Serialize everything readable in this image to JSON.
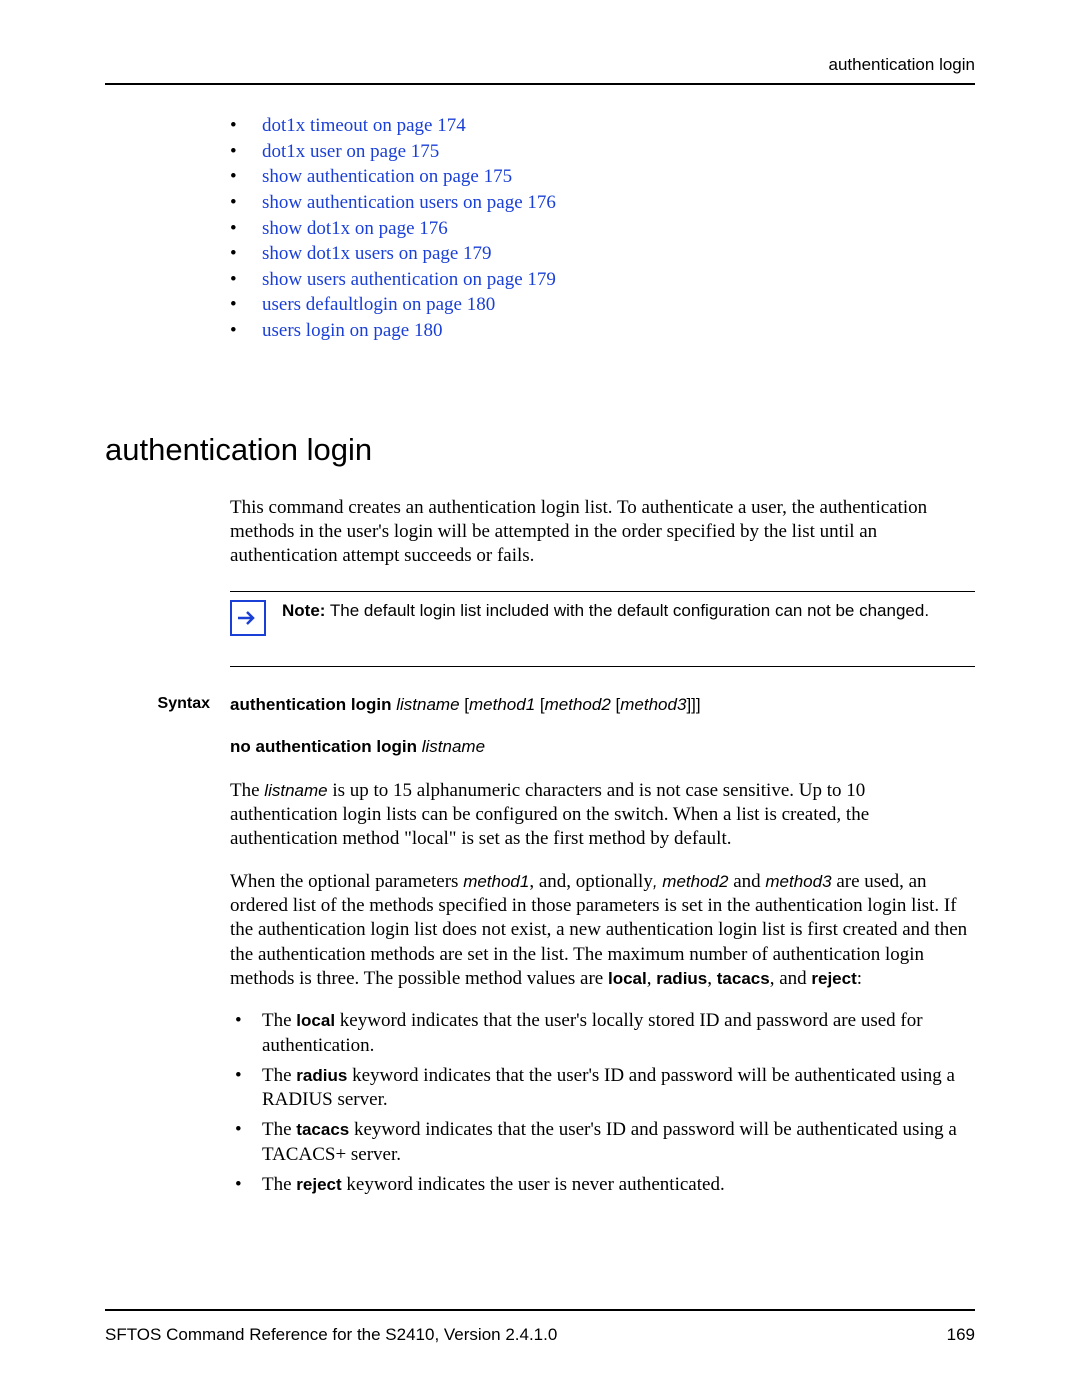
{
  "header": {
    "right": "authentication login"
  },
  "links": [
    "dot1x timeout on page 174",
    "dot1x user on page 175",
    "show authentication on page 175",
    "show authentication users on page 176",
    "show dot1x on page 176",
    "show dot1x users on page 179",
    "show users authentication on page 179",
    "users defaultlogin on page 180",
    "users login on page 180"
  ],
  "section": {
    "title": "authentication login",
    "intro": "This command creates an authentication login list. To authenticate a user, the authentication methods in the user's login will be attempted in the order specified by the list until an authentication attempt succeeds or fails."
  },
  "note": {
    "label": "Note:",
    "text": " The default login list included with the default configuration can not be changed."
  },
  "syntax": {
    "label": "Syntax",
    "cmd1_a": "authentication login",
    "cmd1_b": "listname",
    "cmd1_c": "[",
    "cmd1_d": "method1",
    "cmd1_e": " [",
    "cmd1_f": "method2",
    "cmd1_g": " [",
    "cmd1_h": "method3",
    "cmd1_i": "]]]",
    "cmd2_a": "no authentication login",
    "cmd2_b": "listname"
  },
  "body": {
    "p1_a": "The ",
    "p1_b": "listname",
    "p1_c": "  is up to 15 alphanumeric characters and is not case sensitive. Up to 10 authentication login lists can be configured on the switch. When a list is created, the authentication method \"local\" is set as the first method by default.",
    "p2_a": "When the optional parameters ",
    "p2_b": "method1",
    "p2_c": ", and, optionally",
    "p2_d": ", method2",
    "p2_e": " and ",
    "p2_f": "method3",
    "p2_g": " are used, an ordered list of the methods specified in those parameters is set in the authentication login list. If the authentication login list does not exist, a new authentication login list is first created and then the authentication methods are set in the list. The maximum number of authentication login methods is three. The possible method values are ",
    "p2_h": "local",
    "p2_i": ", ",
    "p2_j": "radius",
    "p2_k": ", ",
    "p2_l": "tacacs",
    "p2_m": ", and  ",
    "p2_n": "reject",
    "p2_o": ":"
  },
  "methods": {
    "m1_a": "The ",
    "m1_b": "local",
    "m1_c": " keyword indicates that the user's locally stored ID and password are used for authentication.",
    "m2_a": "The ",
    "m2_b": "radius",
    "m2_c": " keyword indicates that the user's ID and password will be authenticated using a RADIUS server.",
    "m3_a": "The ",
    "m3_b": "tacacs",
    "m3_c": " keyword indicates that the user's ID and password will be authenticated using a TACACS+ server.",
    "m4_a": "The ",
    "m4_b": "reject",
    "m4_c": " keyword indicates the user is never authenticated."
  },
  "footer": {
    "left": "SFTOS Command Reference for the S2410, Version 2.4.1.0",
    "right": "169"
  }
}
